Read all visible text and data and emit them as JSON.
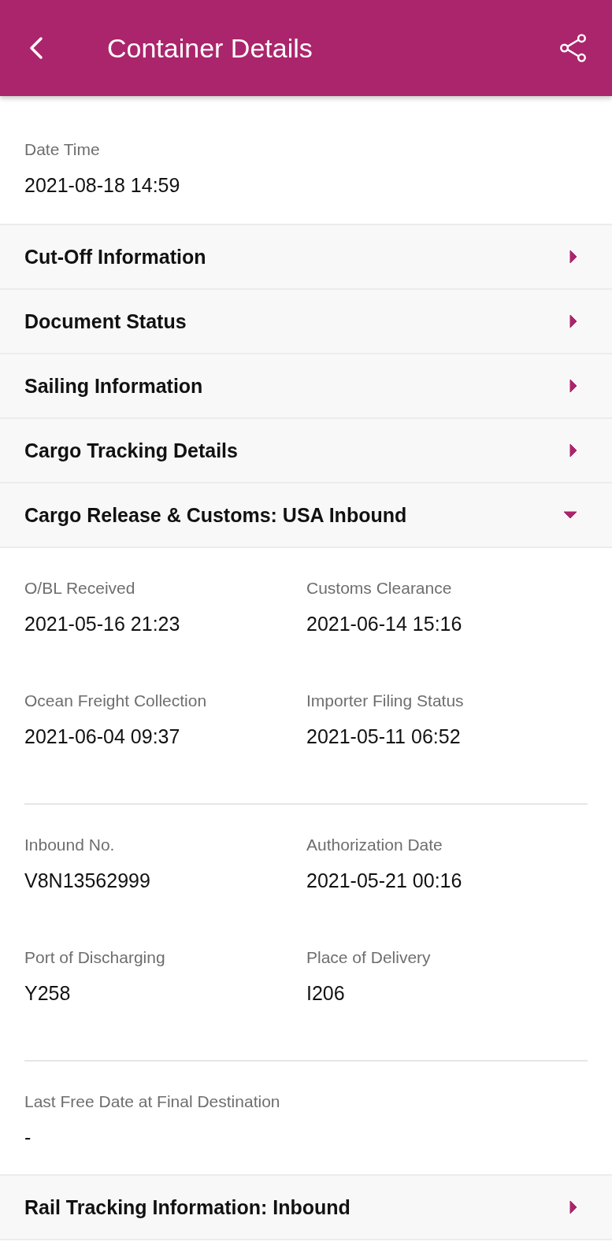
{
  "app_bar": {
    "title": "Container Details"
  },
  "summary": {
    "fields": [
      {
        "label": "Date Time",
        "value": "2021-08-18 14:59"
      }
    ]
  },
  "sections": [
    {
      "title": "Cut-Off Information",
      "expanded": false
    },
    {
      "title": "Document Status",
      "expanded": false
    },
    {
      "title": "Sailing Information",
      "expanded": false
    },
    {
      "title": "Cargo Tracking Details",
      "expanded": false
    },
    {
      "title": "Cargo Release & Customs: USA Inbound",
      "expanded": true,
      "groups": [
        {
          "fields": [
            {
              "label": "O/BL Received",
              "value": "2021-05-16 21:23"
            },
            {
              "label": "Customs Clearance",
              "value": "2021-06-14 15:16"
            },
            {
              "label": "Ocean Freight Collection",
              "value": "2021-06-04 09:37"
            },
            {
              "label": "Importer Filing Status",
              "value": "2021-05-11 06:52"
            }
          ]
        },
        {
          "fields": [
            {
              "label": "Inbound No.",
              "value": "V8N13562999"
            },
            {
              "label": "Authorization Date",
              "value": "2021-05-21 00:16"
            },
            {
              "label": "Port of Discharging",
              "value": "Y258"
            },
            {
              "label": "Place of Delivery",
              "value": "I206"
            }
          ]
        },
        {
          "fields": [
            {
              "label": "Last Free Date at Final Destination",
              "value": "-"
            }
          ]
        }
      ]
    },
    {
      "title": "Rail Tracking Information: Inbound",
      "expanded": false
    }
  ]
}
